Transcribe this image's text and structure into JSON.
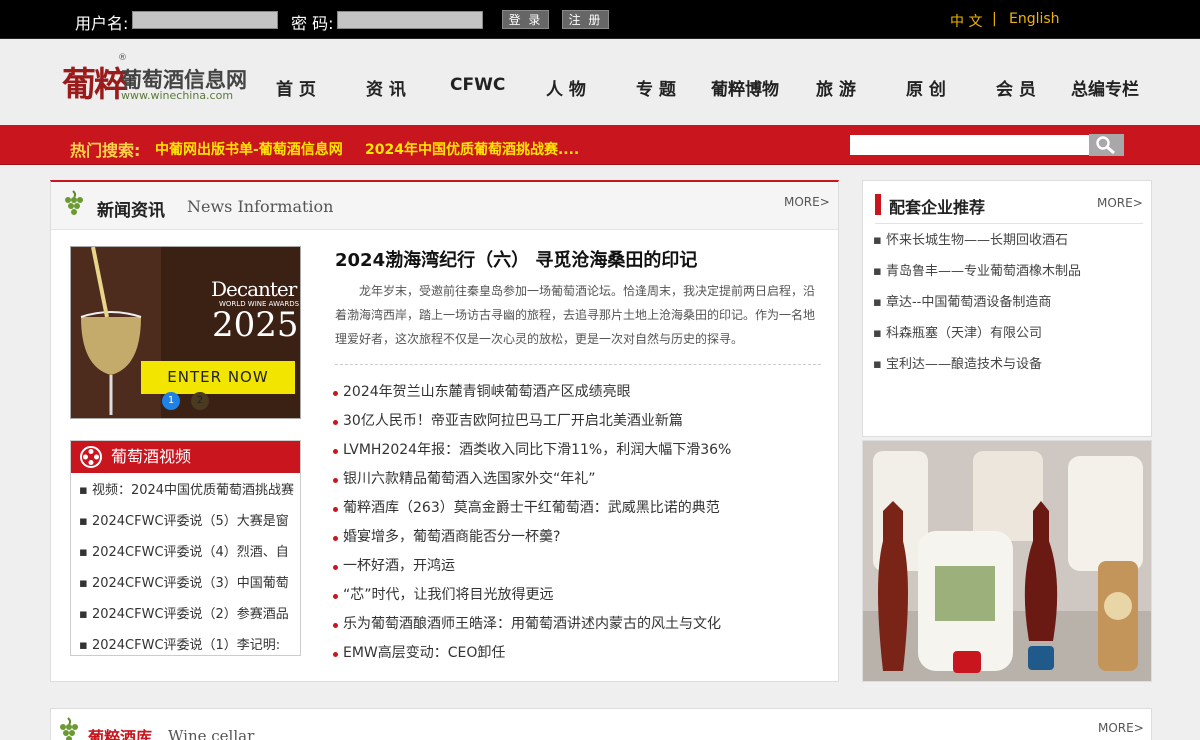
{
  "topbar": {
    "username_label": "用户名:",
    "password_label": "密 码:",
    "login_label": "登 录",
    "register_label": "注 册",
    "lang_zh": "中 文",
    "lang_sep": "|",
    "lang_en": "English"
  },
  "logo": {
    "mark": "葡粹",
    "registered": "®",
    "name": "葡萄酒信息网",
    "url": "www.winechina.com"
  },
  "nav": [
    "首 页",
    "资 讯",
    "CFWC",
    "人 物",
    "专 题",
    "葡粹博物",
    "旅 游",
    "原 创",
    "会 员",
    "总编专栏"
  ],
  "hot": {
    "title": "热门搜索:",
    "links": [
      "中葡网出版书单-葡萄酒信息网",
      "2024年中国优质葡萄酒挑战赛...."
    ]
  },
  "search": {
    "value": "",
    "placeholder": ""
  },
  "news": {
    "title": "新闻资讯",
    "title_en": "News Information",
    "more": "MORE>",
    "promo": {
      "brand": "Decanter",
      "sub": "WORLD WINE AWARDS",
      "year": "2025",
      "cta": "ENTER NOW",
      "pages": [
        "1",
        "2"
      ]
    },
    "headline": "2024渤海湾纪行（六） 寻觅沧海桑田的印记",
    "summary": "龙年岁末，受邀前往秦皇岛参加一场葡萄酒论坛。恰逢周末，我决定提前两日启程，沿着渤海湾西岸，踏上一场访古寻幽的旅程，去追寻那片土地上沧海桑田的印记。作为一名地理爱好者，这次旅程不仅是一次心灵的放松，更是一次对自然与历史的探寻。",
    "items": [
      "2024年贺兰山东麓青铜峡葡萄酒产区成绩亮眼",
      "30亿人民币！帝亚吉欧阿拉巴马工厂开启北美酒业新篇",
      "LVMH2024年报：酒类收入同比下滑11%，利润大幅下滑36%",
      "银川六款精品葡萄酒入选国家外交“年礼”",
      "葡粹酒库（263）莫高金爵士干红葡萄酒：武威黑比诺的典范",
      "婚宴增多，葡萄酒商能否分一杯羹?",
      "一杯好酒，开鸿运",
      "“芯”时代，让我们将目光放得更远",
      "乐为葡萄酒酿酒师王皓泽：用葡萄酒讲述内蒙古的风土与文化",
      "EMW高层变动：CEO卸任"
    ]
  },
  "video": {
    "title": "葡萄酒视频",
    "items": [
      "视频：2024中国优质葡萄酒挑战赛",
      "2024CFWC评委说（5）大赛是窗",
      "2024CFWC评委说（4）烈酒、自",
      "2024CFWC评委说（3）中国葡萄",
      "2024CFWC评委说（2）参赛酒品",
      "2024CFWC评委说（1）李记明:"
    ]
  },
  "partners": {
    "title": "配套企业推荐",
    "more": "MORE>",
    "items": [
      "怀来长城生物——长期回收酒石",
      "青岛鲁丰——专业葡萄酒橡木制品",
      "章达--中国葡萄酒设备制造商",
      "科森瓶塞（天津）有限公司",
      "宝利达——酿造技术与设备"
    ]
  },
  "cellar": {
    "title": "葡粹酒库",
    "title_en": "Wine cellar",
    "more": "MORE>"
  },
  "colors": {
    "brand_red": "#c9151e",
    "gold": "#f0b400",
    "yellow": "#ffe600"
  }
}
